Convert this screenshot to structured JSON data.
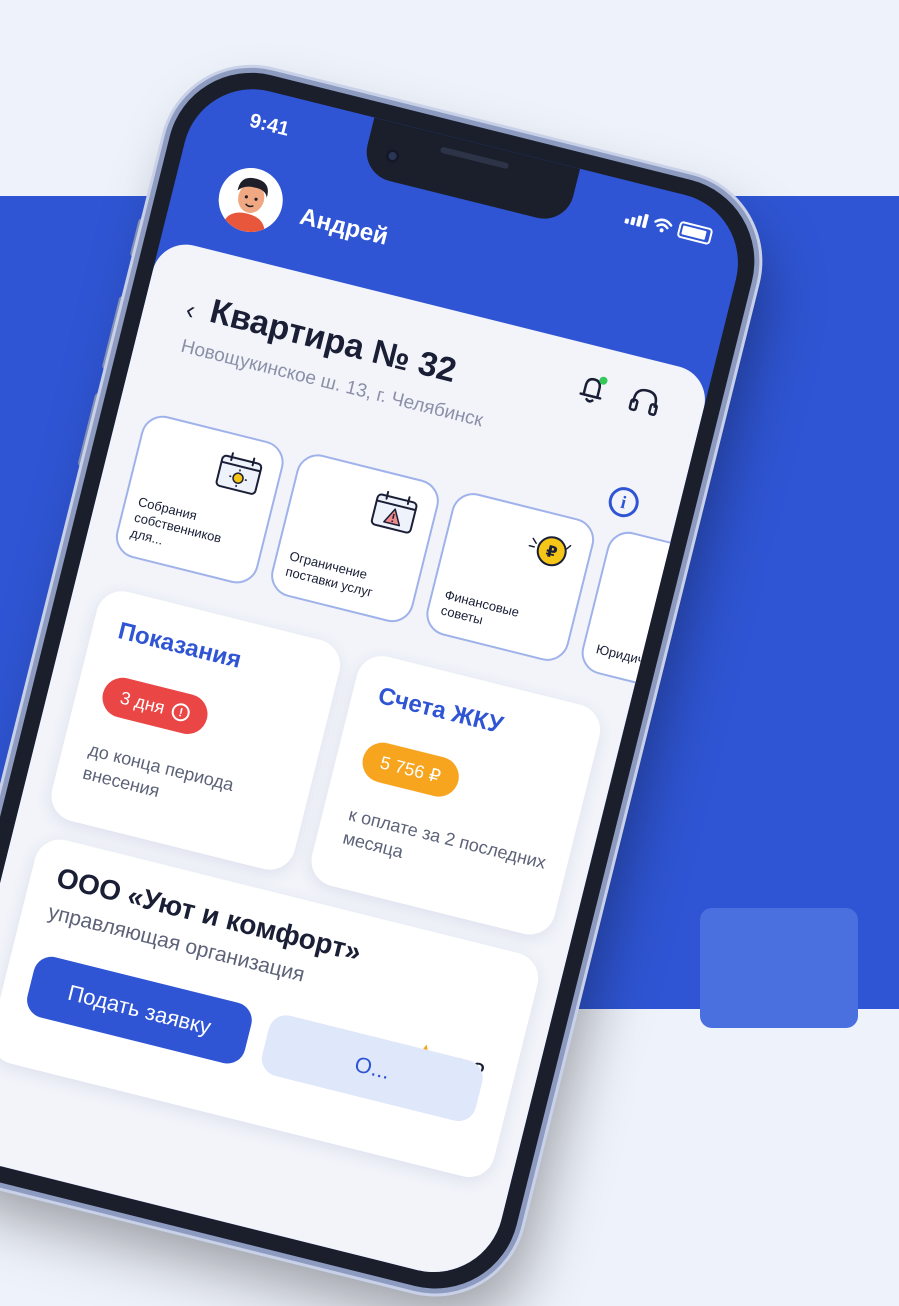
{
  "status_bar": {
    "time": "9:41"
  },
  "header": {
    "user_name": "Андрей"
  },
  "property": {
    "back_glyph": "‹",
    "title": "Квартира № 32",
    "address": "Новощукинское ш. 13, г. Челябинск",
    "info_glyph": "i"
  },
  "tiles": [
    {
      "label": "Собрания собственников для...",
      "icon": "calendar-sun-icon"
    },
    {
      "label": "Ограничение поставки услуг",
      "icon": "calendar-warning-icon"
    },
    {
      "label": "Финансовые советы",
      "icon": "ruble-coin-icon"
    },
    {
      "label": "Юридиче практик",
      "icon": "legal-icon"
    }
  ],
  "readings": {
    "title": "Показания",
    "badge": "3 дня",
    "note": "до конца периода внесения"
  },
  "bills": {
    "title": "Счета ЖКУ",
    "amount": "5 756 ₽",
    "note": "к оплате за 2 последних месяца"
  },
  "organization": {
    "name": "ООО «Уют и комфорт»",
    "subtitle": "управляющая организация",
    "rating": "4.2",
    "submit_button": "Подать заявку",
    "secondary_button": "О..."
  },
  "colors": {
    "brand_blue": "#2f55d4",
    "alert_red": "#ea4646",
    "amount_orange": "#f7a51f",
    "star_orange": "#f5a623"
  }
}
